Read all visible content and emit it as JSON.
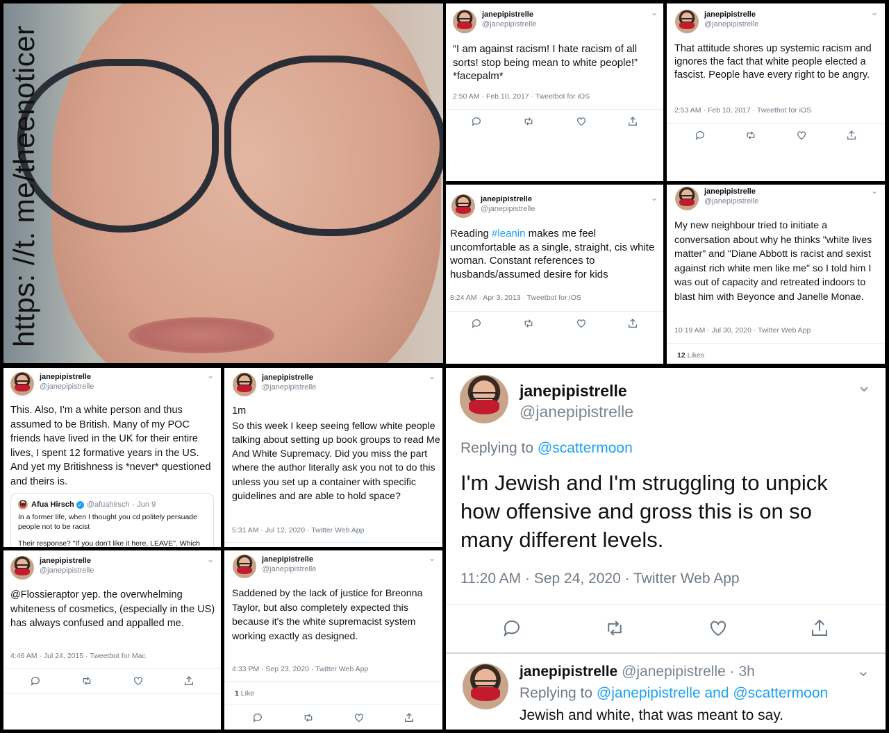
{
  "watermark": "https: //t. me/theenoticer",
  "tweets": {
    "t1": {
      "name": "janepipistrelle",
      "handle": "@janepipistrelle",
      "text": "“I am against racism! I hate racism of all sorts! stop being mean to white people!” *facepalm*",
      "meta": "2:50 AM · Feb 10, 2017 · Tweetbot for iOS"
    },
    "t2": {
      "name": "janepipistrelle",
      "handle": "@janepipistrelle",
      "text": "That attitude shores up systemic racism and ignores the fact that white people elected a fascist. People have every right to be angry.",
      "meta": "2:53 AM · Feb 10, 2017 · Tweetbot for iOS"
    },
    "t3": {
      "name": "janepipistrelle",
      "handle": "@janepipistrelle",
      "text_before": "Reading ",
      "hashtag": "#leanin",
      "text_after": " makes me feel uncomfortable as a single, straight, cis white woman. Constant references to husbands/assumed desire for kids",
      "meta": "8:24 AM · Apr 3, 2013 · Tweetbot for iOS"
    },
    "t4": {
      "name": "janepipistrelle",
      "handle": "@janepipistrelle",
      "text": "My new neighbour tried to initiate a conversation about why he thinks \"white lives matter\" and \"Diane Abbott is racist and sexist against rich white men like me\" so I told him I was out of capacity and retreated indoors to blast him with Beyonce and Janelle Monae.",
      "meta": "10:19 AM · Jul 30, 2020 · Twitter Web App",
      "likes_count": "12",
      "likes_label": "Likes"
    },
    "t5": {
      "name": "janepipistrelle",
      "handle": "@janepipistrelle",
      "text": "This. Also, I'm a white person and thus assumed to be British. Many of my POC friends have lived in the UK for their entire lives, I spent 12 formative years in the US. And yet my Britishness is *never* questioned and theirs is.",
      "quote": {
        "name": "Afua Hirsch",
        "handle": "@afuahirsch",
        "date": "· Jun 9",
        "text": "In a former life, when I thought you cd politely persuade people not to be racist",
        "text2": "Their response? \"If you don't like it here, LEAVE\". Which"
      }
    },
    "t6": {
      "name": "janepipistrelle",
      "handle": "@janepipistrelle",
      "time": "1m",
      "text": "So this week I keep seeing fellow white people talking about setting up book groups to read Me And White Supremacy. Did you miss the part where the author literally ask you not to do this unless you set up a container with specific guidelines and are able to hold space?",
      "meta": "5:31 AM · Jul 12, 2020 · Twitter Web App"
    },
    "t7": {
      "name": "janepipistrelle",
      "handle": "@janepipistrelle",
      "text": "@Flossieraptor yep. the overwhelming whiteness of cosmetics, (especially in the US) has always confused and appalled me.",
      "meta": "4:46 AM · Jul 24, 2015 · Tweetbot for Mac"
    },
    "t8": {
      "name": "janepipistrelle",
      "handle": "@janepipistrelle",
      "text": "Saddened by the lack of justice for Breonna Taylor, but also completely expected this because it's the white supremacist system working exactly as designed.",
      "meta": "4:33 PM · Sep 23, 2020 · Twitter Web App",
      "likes_count": "1",
      "likes_label": "Like"
    },
    "t9": {
      "name": "janepipistrelle",
      "handle": "@janepipistrelle",
      "replying_label": "Replying to ",
      "replying_to": "@scattermoon",
      "text": "I'm Jewish and I'm struggling to unpick how offensive and gross this is on so many different levels.",
      "meta": "11:20 AM · Sep 24, 2020 · Twitter Web App",
      "reply": {
        "name": "janepipistrelle",
        "handle": "@janepipistrelle",
        "time": "· 3h",
        "replying_label": "Replying to ",
        "replying_to": "@janepipistrelle and @scattermoon",
        "text": "Jewish and white, that was meant to say."
      }
    }
  },
  "icons": {
    "reply": "reply-icon",
    "retweet": "retweet-icon",
    "like": "heart-icon",
    "share": "share-icon",
    "chevron": "chevron-down-icon",
    "verified": "verified-badge-icon"
  },
  "colors": {
    "link": "#1da1f2",
    "meta": "#6f7b86",
    "divider": "#e6ecf0",
    "verified": "#1da1f2"
  }
}
